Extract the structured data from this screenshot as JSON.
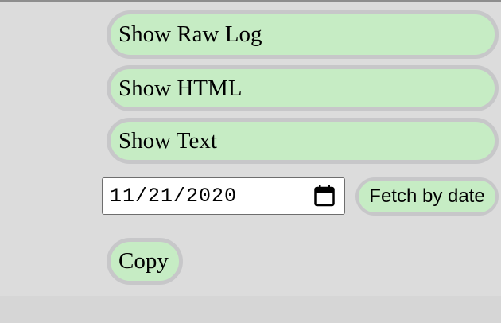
{
  "buttons": {
    "show_raw_log": "Show Raw Log",
    "show_html": "Show HTML",
    "show_text": "Show Text",
    "fetch_by_date": "Fetch by date",
    "copy": "Copy"
  },
  "date_input": {
    "value": "11/21/2020",
    "icon": "calendar-icon"
  },
  "colors": {
    "button_fill": "#c6ecc4",
    "button_border": "#c7c7c9",
    "background": "#dcdcdc"
  }
}
